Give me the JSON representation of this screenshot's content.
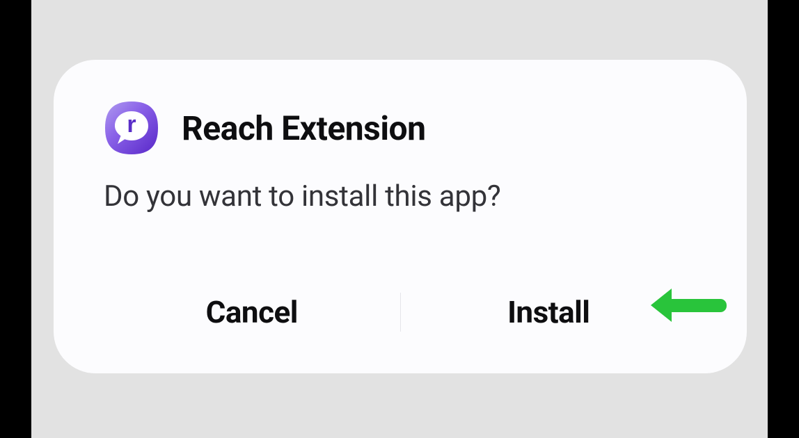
{
  "dialog": {
    "title": "Reach Extension",
    "prompt": "Do you want to install this app?",
    "cancel_label": "Cancel",
    "install_label": "Install"
  }
}
